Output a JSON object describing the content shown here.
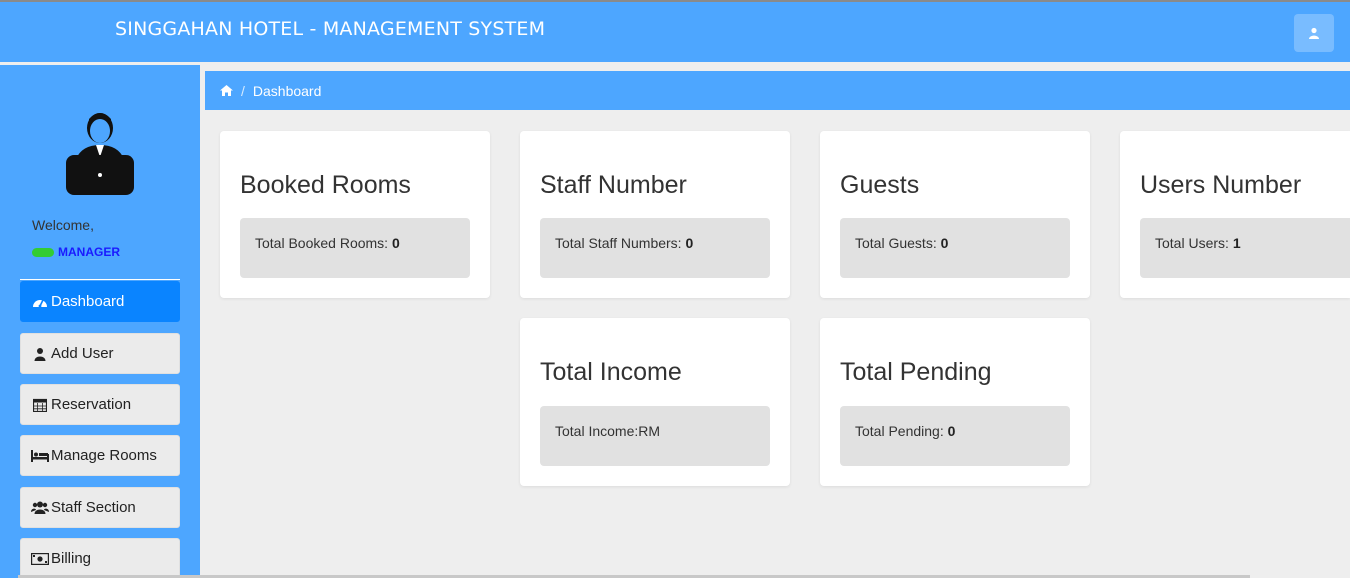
{
  "header": {
    "title": "SINGGAHAN HOTEL - MANAGEMENT SYSTEM",
    "user_icon": "user-icon"
  },
  "sidebar": {
    "avatar_icon": "manager-avatar-icon",
    "welcome": "Welcome,",
    "role": "MANAGER",
    "items": [
      {
        "label": "Dashboard",
        "icon": "dashboard-icon",
        "active": true
      },
      {
        "label": "Add User",
        "icon": "user-icon",
        "active": false
      },
      {
        "label": "Reservation",
        "icon": "calendar-icon",
        "active": false
      },
      {
        "label": "Manage Rooms",
        "icon": "bed-icon",
        "active": false
      },
      {
        "label": "Staff Section",
        "icon": "users-icon",
        "active": false
      },
      {
        "label": "Billing",
        "icon": "money-icon",
        "active": false
      }
    ]
  },
  "breadcrumb": {
    "home_icon": "home-icon",
    "separator": "/",
    "current": "Dashboard"
  },
  "cards": [
    {
      "title": "Booked Rooms",
      "label": "Total Booked Rooms: ",
      "value": "0"
    },
    {
      "title": "Staff Number",
      "label": "Total Staff Numbers: ",
      "value": "0"
    },
    {
      "title": "Guests",
      "label": "Total Guests: ",
      "value": "0"
    },
    {
      "title": "Users Number",
      "label": "Total Users: ",
      "value": "1"
    },
    {
      "title": "Total Income",
      "label": "Total Income:RM",
      "value": ""
    },
    {
      "title": "Total Pending",
      "label": "Total Pending: ",
      "value": "0"
    }
  ],
  "colors": {
    "primary": "#4da6ff",
    "active": "#0a84ff",
    "role_text": "#1a1aff",
    "status_dot": "#33cc33"
  }
}
